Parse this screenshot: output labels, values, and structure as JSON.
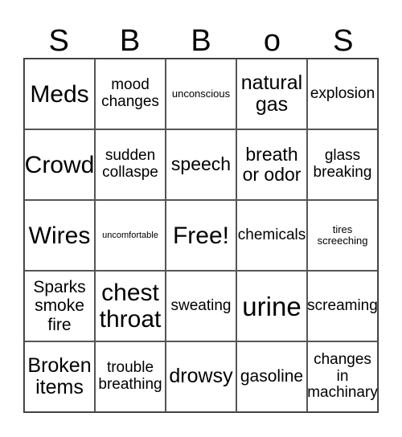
{
  "header": [
    "S",
    "B",
    "B",
    "o",
    "S"
  ],
  "cells": [
    [
      "Meds",
      "mood changes",
      "unconscious",
      "natural gas",
      "explosion"
    ],
    [
      "Crowd",
      "sudden collaspe",
      "speech",
      "breath or odor",
      "glass breaking"
    ],
    [
      "Wires",
      "uncomfortable",
      "Free!",
      "chemicals",
      "tires screeching"
    ],
    [
      "Sparks smoke fire",
      "chest throat",
      "sweating",
      "urine",
      "screaming"
    ],
    [
      "Broken items",
      "trouble breathing",
      "drowsy",
      "gasoline",
      "changes in machinary"
    ]
  ]
}
